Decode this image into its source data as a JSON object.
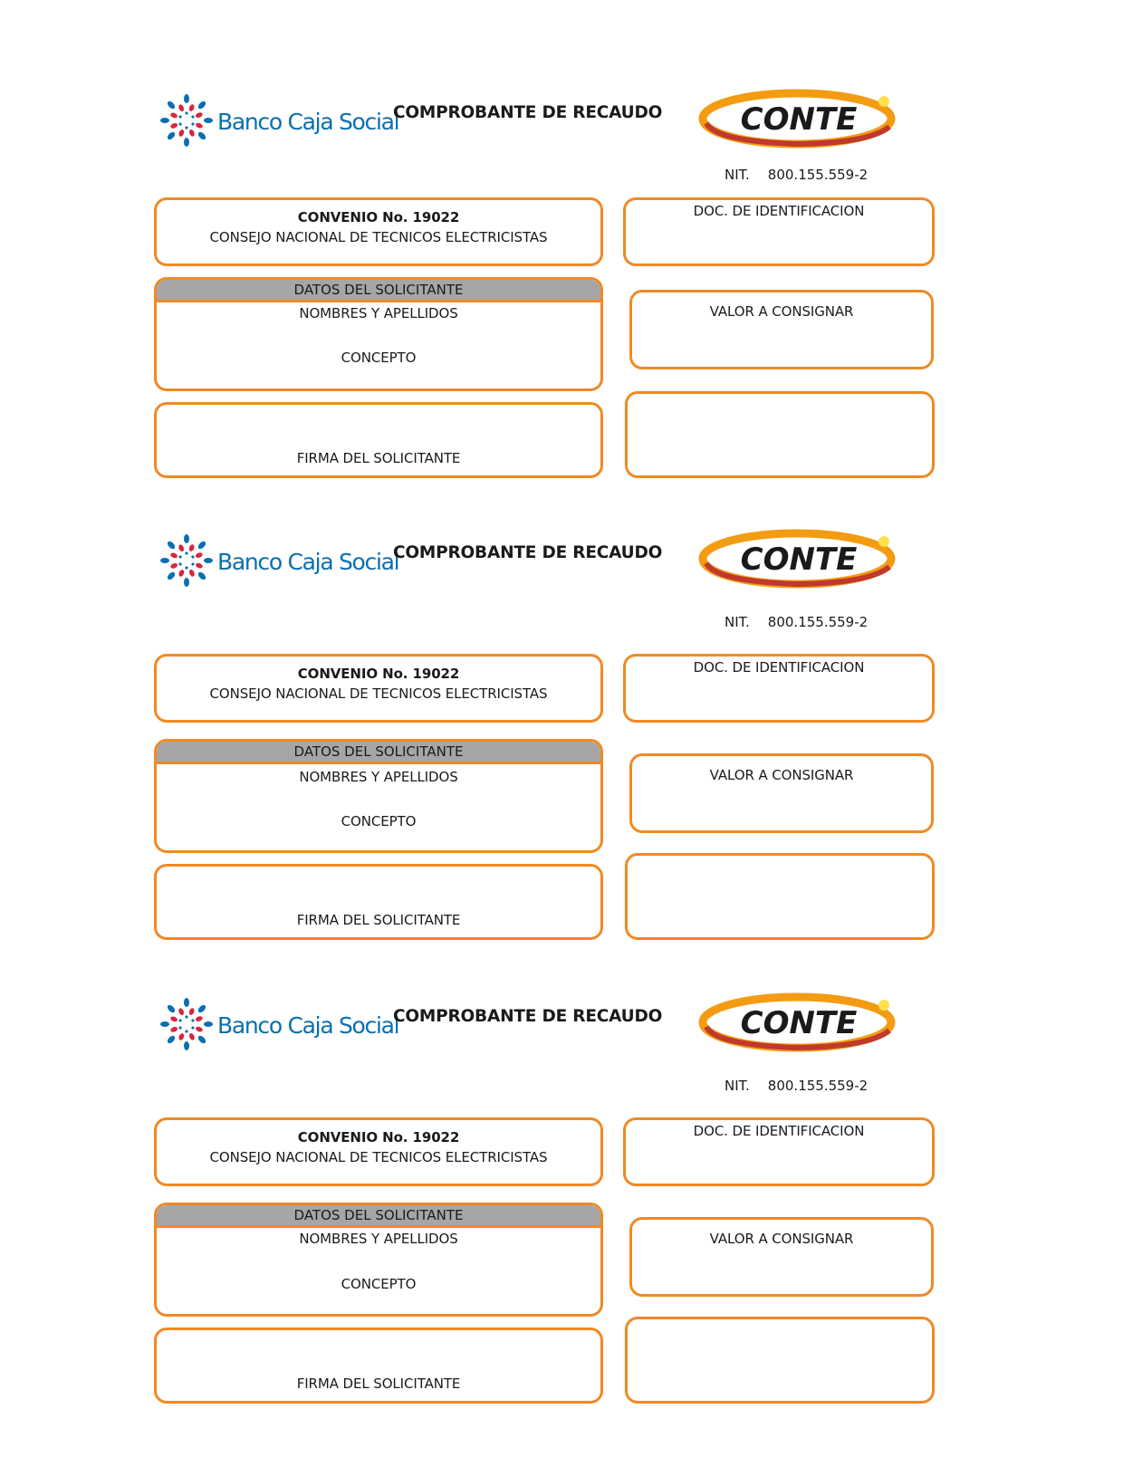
{
  "brand": {
    "bank_name": "Banco Caja Social",
    "company_logo_text": "CONTE",
    "colors": {
      "bank_blue": "#0a6fb0",
      "bank_red": "#d7263d",
      "border_orange": "#f08a24",
      "header_gray": "#a6a6a6",
      "logo_orange": "#f39c12",
      "logo_red": "#c0392b"
    }
  },
  "slips": [
    {
      "title": "COMPROBANTE DE RECAUDO",
      "nit_label": "NIT.",
      "nit_value": "800.155.559-2",
      "convenio_title": "CONVENIO No. 19022",
      "convenio_name": "CONSEJO NACIONAL DE TECNICOS ELECTRICISTAS",
      "doc_label": "DOC. DE IDENTIFICACION",
      "datos_header": "DATOS DEL SOLICITANTE",
      "nombres_label": "NOMBRES Y APELLIDOS",
      "concepto_label": "CONCEPTO",
      "valor_label": "VALOR A CONSIGNAR",
      "firma_label": "FIRMA DEL SOLICITANTE"
    },
    {
      "title": "COMPROBANTE DE RECAUDO",
      "nit_label": "NIT.",
      "nit_value": "800.155.559-2",
      "convenio_title": "CONVENIO No. 19022",
      "convenio_name": "CONSEJO NACIONAL DE TECNICOS ELECTRICISTAS",
      "doc_label": "DOC. DE IDENTIFICACION",
      "datos_header": "DATOS DEL SOLICITANTE",
      "nombres_label": "NOMBRES Y APELLIDOS",
      "concepto_label": "CONCEPTO",
      "valor_label": "VALOR A CONSIGNAR",
      "firma_label": "FIRMA DEL SOLICITANTE"
    },
    {
      "title": "COMPROBANTE DE RECAUDO",
      "nit_label": "NIT.",
      "nit_value": "800.155.559-2",
      "convenio_title": "CONVENIO No. 19022",
      "convenio_name": "CONSEJO NACIONAL DE TECNICOS ELECTRICISTAS",
      "doc_label": "DOC. DE IDENTIFICACION",
      "datos_header": "DATOS DEL SOLICITANTE",
      "nombres_label": "NOMBRES Y APELLIDOS",
      "concepto_label": "CONCEPTO",
      "valor_label": "VALOR A CONSIGNAR",
      "firma_label": "FIRMA DEL SOLICITANTE"
    }
  ]
}
